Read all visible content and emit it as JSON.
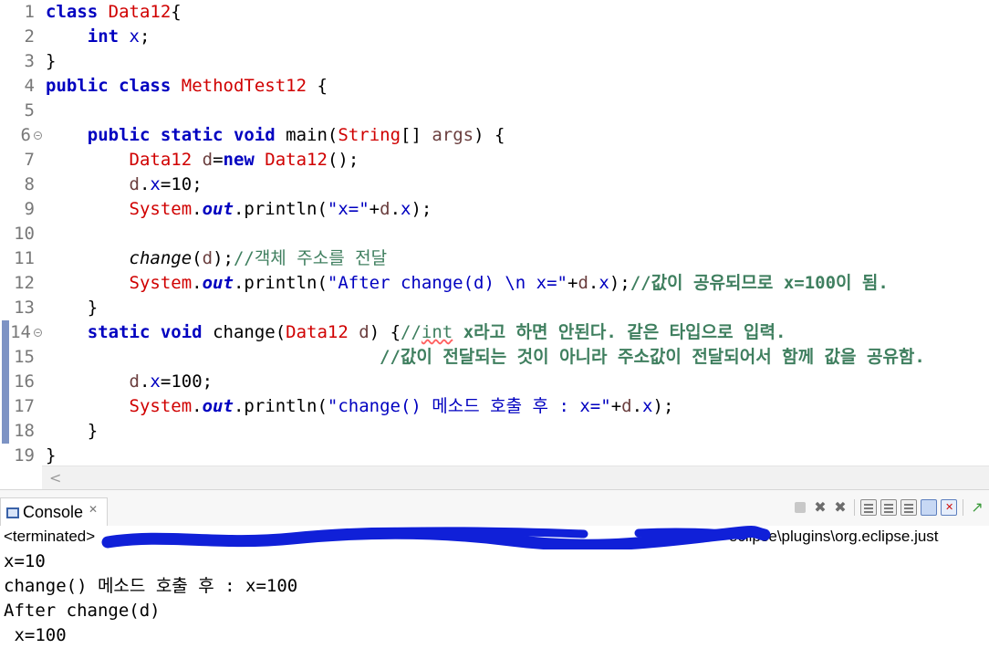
{
  "editor": {
    "line_numbers": [
      "1",
      "2",
      "3",
      "4",
      "5",
      "6",
      "7",
      "8",
      "9",
      "10",
      "11",
      "12",
      "13",
      "14",
      "15",
      "16",
      "17",
      "18",
      "19"
    ],
    "scroll_left_arrow": "<",
    "code": {
      "l1": {
        "kw": "class",
        "name": "Data12",
        "brace": "{"
      },
      "l2": {
        "kw": "int",
        "var": "x",
        "semi": ";"
      },
      "l3": {
        "brace": "}"
      },
      "l4": {
        "kw1": "public",
        "kw2": "class",
        "name": "MethodTest12",
        "brace": "{"
      },
      "l6": {
        "kw1": "public",
        "kw2": "static",
        "kw3": "void",
        "method": "main(",
        "type": "String",
        "arr": "[] ",
        "param": "args",
        "rest": ") {"
      },
      "l7": {
        "type": "Data12",
        "var": "d",
        "eq": "=",
        "kw": "new",
        "ctor": "Data12",
        "rest": "();"
      },
      "l8": {
        "obj": "d",
        "dot": ".",
        "field": "x",
        "rest": "=10;"
      },
      "l9": {
        "cls": "System",
        "dot": ".",
        "out": "out",
        "call": ".println(",
        "str": "\"x=\"",
        "plus": "+",
        "obj": "d",
        "dot2": ".",
        "field": "x",
        "end": ");"
      },
      "l11": {
        "method": "change",
        "args_open": "(",
        "arg": "d",
        "args_close": ");",
        "comment": "//객체 주소를 전달"
      },
      "l12": {
        "cls": "System",
        "dot": ".",
        "out": "out",
        "call": ".println(",
        "str": "\"After change(d) \\n x=\"",
        "plus": "+",
        "obj": "d",
        "dot2": ".",
        "field": "x",
        "end": ");",
        "comment": "//값이 공유되므로 x=100이 됨."
      },
      "l13": {
        "brace": "}"
      },
      "l14": {
        "kw": "static",
        "kw2": "void",
        "method": "change(",
        "type": "Data12",
        "param": "d",
        "rest": ") {",
        "comment_a": "//",
        "comment_b": "int",
        "comment_c": " x라고 하면 안된다. 같은 타입으로 입력."
      },
      "l15": {
        "comment": "//값이 전달되는 것이 아니라 주소값이 전달되어서 함께 값을 공유함."
      },
      "l16": {
        "obj": "d",
        "dot": ".",
        "field": "x",
        "rest": "=100;"
      },
      "l17": {
        "cls": "System",
        "dot": ".",
        "out": "out",
        "call": ".println(",
        "str": "\"change() 메소드 호출 후 : x=\"",
        "plus": "+",
        "obj": "d",
        "dot2": ".",
        "field": "x",
        "end": ");"
      },
      "l18": {
        "brace": "}"
      },
      "l19": {
        "brace": "}"
      }
    }
  },
  "console": {
    "tab_label": "Console",
    "tab_close": "✕",
    "status_prefix": "<terminated> ",
    "status_visible_suffix": "eclipse\\plugins\\org.eclipse.just",
    "output": [
      "x=10",
      "change() 메소드 호출 후 : x=100",
      "After change(d)",
      " x=100"
    ]
  },
  "colors": {
    "keyword": "#0000c0",
    "type": "#d00000",
    "comment": "#3f7f5f",
    "local_var": "#6a3e3e",
    "redaction": "#1020d8"
  }
}
